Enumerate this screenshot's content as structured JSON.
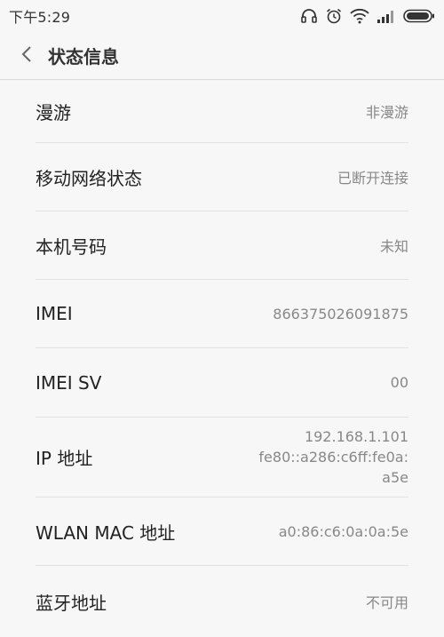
{
  "status_bar": {
    "time": "下午5:29",
    "icons": [
      "headphones-icon",
      "alarm-icon",
      "wifi-icon",
      "signal-icon",
      "battery-icon"
    ]
  },
  "header": {
    "title": "状态信息",
    "back_icon": "chevron-left-icon"
  },
  "rows": [
    {
      "label": "漫游",
      "value": "非漫游"
    },
    {
      "label": "移动网络状态",
      "value": "已断开连接"
    },
    {
      "label": "本机号码",
      "value": "未知"
    },
    {
      "label": "IMEI",
      "value": "866375026091875"
    },
    {
      "label": "IMEI SV",
      "value": "00"
    },
    {
      "label": "IP 地址",
      "value": "192.168.1.101\nfe80::a286:c6ff:fe0a:\na5e"
    },
    {
      "label": "WLAN MAC 地址",
      "value": "a0:86:c6:0a:0a:5e"
    },
    {
      "label": "蓝牙地址",
      "value": "不可用"
    }
  ],
  "colors": {
    "background": "#f8f7f8",
    "label": "#222222",
    "value": "#888888",
    "divider": "#e4e2e4"
  }
}
